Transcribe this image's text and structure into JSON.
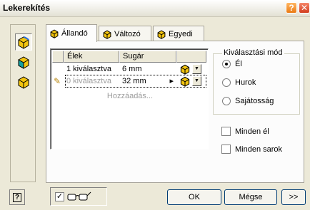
{
  "window": {
    "title": "Lekerekítés",
    "help_symbol": "?",
    "minimize_symbol": "?",
    "close_symbol": "✕"
  },
  "tabs": [
    {
      "label": "Állandó",
      "active": true
    },
    {
      "label": "Változó",
      "active": false
    },
    {
      "label": "Egyedi",
      "active": false
    }
  ],
  "grid": {
    "headers": [
      "Élek",
      "Sugár"
    ],
    "rows": [
      {
        "edges": "1 kiválasztva",
        "radius": "6 mm",
        "state": "normal"
      },
      {
        "edges": "0 kiválasztva",
        "radius": "32 mm",
        "state": "editing",
        "step_glyph": "▸"
      }
    ],
    "add_text": "Hozzáadás...",
    "dropdown_glyph": "▼",
    "pencil_glyph": "✎"
  },
  "selection_mode": {
    "legend": "Kiválasztási mód",
    "options": [
      {
        "label": "Él",
        "checked": true
      },
      {
        "label": "Hurok",
        "checked": false
      },
      {
        "label": "Sajátosság",
        "checked": false
      }
    ]
  },
  "options": [
    {
      "label": "Minden él",
      "checked": false
    },
    {
      "label": "Minden sarok",
      "checked": false
    }
  ],
  "footer": {
    "preview_checked": true,
    "check_glyph": "✓",
    "help_label": "?",
    "ok_label": "OK",
    "cancel_label": "Mégse",
    "more_label": ">>"
  },
  "colors": {
    "accent_yellow": "#f2c40f",
    "accent_blue": "#2a6ed8",
    "accent_teal": "#15a0a0"
  }
}
